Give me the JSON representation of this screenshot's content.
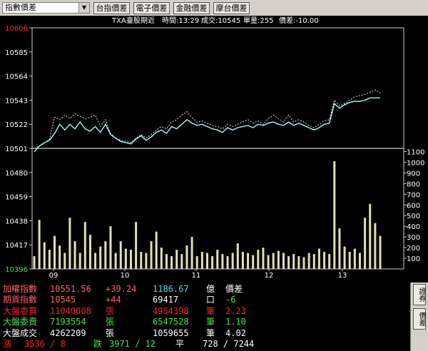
{
  "toolbar": {
    "selector_value": "指數價差",
    "buttons": [
      "台指價差",
      "電子價差",
      "金融價差",
      "摩台價差"
    ]
  },
  "status": {
    "symbol": "TXA",
    "contract": "臺股期近",
    "time": "時間:13:29",
    "volume": "成交:10545",
    "lot": "單量:255",
    "spread": "價差:-10.00"
  },
  "chart_data": {
    "type": "line",
    "title": "",
    "price_axis": {
      "ticks": [
        "10606",
        "10585",
        "10564",
        "10543",
        "10522",
        "10501",
        "10480",
        "10459",
        "10438",
        "10417",
        "10396"
      ],
      "min": 10396,
      "max": 10606,
      "reference": 10501
    },
    "volume_axis": {
      "ticks": [
        "1100",
        "1000",
        "900",
        "800",
        "700",
        "600",
        "500",
        "400",
        "300",
        "200",
        "100"
      ],
      "min": 0,
      "max": 1150
    },
    "x_ticks": [
      "09",
      "10",
      "11",
      "12",
      "13"
    ],
    "series": [
      {
        "name": "futures",
        "color": "#aef5f5",
        "values": [
          10498,
          10503,
          10506,
          10508,
          10514,
          10522,
          10517,
          10522,
          10518,
          10524,
          10518,
          10516,
          10520,
          10515,
          10522,
          10513,
          10510,
          10507,
          10506,
          10505,
          10509,
          10512,
          10508,
          10511,
          10515,
          10517,
          10514,
          10520,
          10518,
          10522,
          10526,
          10523,
          10521,
          10522,
          10520,
          10518,
          10517,
          10515,
          10519,
          10517,
          10519,
          10520,
          10521,
          10519,
          10522,
          10521,
          10523,
          10524,
          10522,
          10521,
          10524,
          10521,
          10523,
          10521,
          10519,
          10517,
          10519,
          10522,
          10523,
          10540,
          10536,
          10539,
          10541,
          10542,
          10542,
          10543,
          10545,
          10545,
          10545
        ]
      },
      {
        "name": "index",
        "color": "#e6e6e6",
        "values": [
          10501,
          10503,
          10506,
          10509,
          10528,
          10526,
          10530,
          10527,
          10531,
          10529,
          10527,
          10528,
          10530,
          10520,
          10526,
          10514,
          10510,
          10508,
          10507,
          10506,
          10510,
          10513,
          10510,
          10513,
          10517,
          10520,
          10518,
          10524,
          10526,
          10530,
          10533,
          10528,
          10524,
          10525,
          10523,
          10521,
          10520,
          10518,
          10522,
          10520,
          10522,
          10524,
          10526,
          10523,
          10525,
          10522,
          10527,
          10530,
          10527,
          10524,
          10530,
          10524,
          10526,
          10524,
          10521,
          10519,
          10522,
          10525,
          10526,
          10543,
          10538,
          10540,
          10543,
          10546,
          10547,
          10548,
          10550,
          10552,
          10549
        ]
      }
    ],
    "volume_values": [
      120,
      460,
      250,
      180,
      310,
      220,
      150,
      480,
      260,
      150,
      440,
      320,
      150,
      210,
      260,
      400,
      150,
      260,
      190,
      180,
      440,
      160,
      150,
      260,
      350,
      200,
      140,
      120,
      180,
      140,
      220,
      300,
      120,
      160,
      150,
      120,
      180,
      140,
      120,
      150,
      240,
      160,
      150,
      130,
      180,
      200,
      130,
      150,
      170,
      150,
      120,
      140,
      120,
      110,
      150,
      140,
      190,
      160,
      140,
      1010,
      380,
      210,
      160,
      190,
      150,
      480,
      610,
      430,
      310
    ],
    "volume_color": "#e0e0b4"
  },
  "info": {
    "rows": [
      [
        {
          "t": "加權指數",
          "c": "#ff6060"
        },
        {
          "t": "10551.56",
          "c": "#ff6060"
        },
        {
          "t": "+39.24",
          "c": "#ff6060"
        },
        {
          "t": "1186.67",
          "c": "#4ae0e0"
        },
        {
          "t": "億",
          "c": "#ffffff"
        },
        {
          "t": "價差",
          "c": "#ffffff"
        }
      ],
      [
        {
          "t": "期貨指數",
          "c": "#ff6060"
        },
        {
          "t": "10545",
          "c": "#ff6060"
        },
        {
          "t": "+44",
          "c": "#ff6060"
        },
        {
          "t": "69417",
          "c": "#ffffff"
        },
        {
          "t": "口",
          "c": "#ffffff"
        },
        {
          "t": "-6",
          "c": "#4ae04a"
        }
      ],
      [
        {
          "t": "大盤委買",
          "c": "#ff2020"
        },
        {
          "t": "11040008",
          "c": "#ff2020"
        },
        {
          "t": "張",
          "c": "#ff2020"
        },
        {
          "t": "4954398",
          "c": "#ff2020"
        },
        {
          "t": "筆",
          "c": "#ff2020"
        },
        {
          "t": "2.23",
          "c": "#ff2020"
        }
      ],
      [
        {
          "t": "大盤委賣",
          "c": "#4ae04a"
        },
        {
          "t": "7193554",
          "c": "#4ae04a"
        },
        {
          "t": "張",
          "c": "#4ae04a"
        },
        {
          "t": "6547528",
          "c": "#4ae04a"
        },
        {
          "t": "筆",
          "c": "#4ae04a"
        },
        {
          "t": "1.10",
          "c": "#4ae04a"
        }
      ],
      [
        {
          "t": "大盤成交",
          "c": "#ffffff"
        },
        {
          "t": "4262209",
          "c": "#ffffff"
        },
        {
          "t": "張",
          "c": "#ffffff"
        },
        {
          "t": "1059655",
          "c": "#ffffff"
        },
        {
          "t": "筆",
          "c": "#ffffff"
        },
        {
          "t": "4.02",
          "c": "#ffffff"
        }
      ]
    ],
    "breadth": {
      "up_label": "漲",
      "up_value": "3536 / 8",
      "down_label": "跌",
      "down_value": "3971 / 12",
      "flat_label": "平",
      "flat_value": "728 / 7244"
    }
  },
  "side_tabs": [
    "證券",
    "價差"
  ]
}
